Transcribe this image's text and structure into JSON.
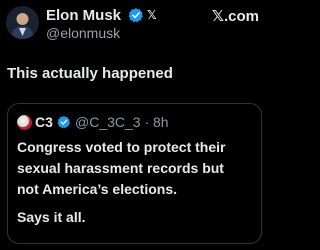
{
  "post": {
    "author": {
      "name": "Elon Musk",
      "handle": "@elonmusk",
      "x_badge": "𝕏",
      "verified_color": "#1d9bf0",
      "avatar_icon": "avatar-portrait"
    },
    "watermark": "𝕏.com",
    "text": "This actually happened",
    "quote": {
      "author_name": "C3",
      "handle_time": "@C_3C_3 · 8h",
      "verified_color": "#1d9bf0",
      "body_lines": [
        "Congress voted to protect their",
        "sexual harassment records but",
        "not America’s elections."
      ],
      "tail": "Says it all."
    }
  }
}
